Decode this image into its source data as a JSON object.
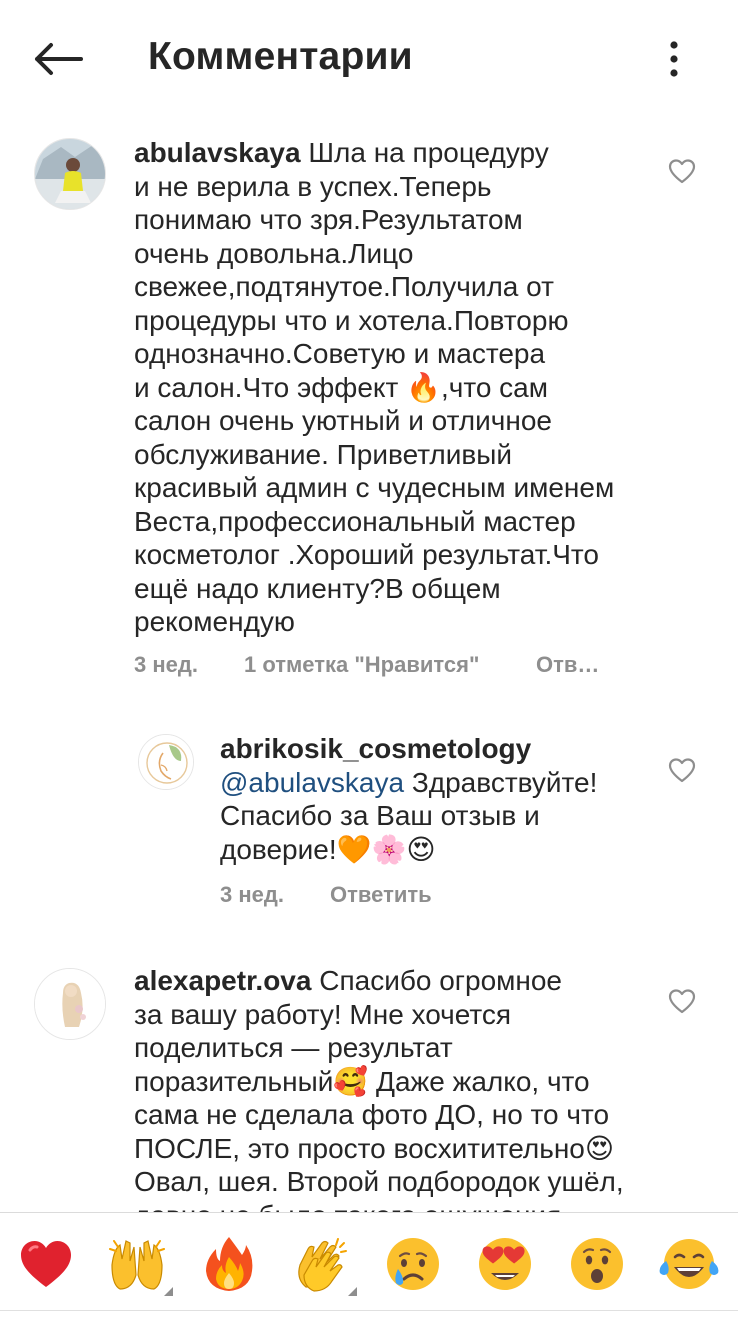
{
  "header": {
    "title": "Комментарии"
  },
  "comments": [
    {
      "username": "abulavskaya",
      "text_lines": [
        "Шла на процедуру",
        "и не верила в успех.Теперь",
        "понимаю что зря.Результатом",
        "очень довольна.Лицо",
        "свежее,подтянутое.Получила от",
        "процедуры что и хотела.Повторю",
        "однозначно.Советую и мастера",
        "и салон.Что эффект 🔥,что сам",
        "салон очень уютный и отличное",
        "обслуживание. Приветливый",
        "красивый админ с чудесным именем",
        "Веста,профессиональный мастер",
        "косметолог .Хороший результат.Что",
        "ещё надо клиенту?В общем",
        "рекомендую"
      ],
      "time": "3 нед.",
      "likes": "1 отметка \"Нравится\"",
      "reply": "Отв…"
    },
    {
      "username": "abrikosik_cosmetology",
      "mention": "@abulavskaya",
      "text_after_mention": " Здравствуйте!",
      "text_lines": [
        "Спасибо за Ваш отзыв и",
        "доверие!🧡🌸😍"
      ],
      "time": "3 нед.",
      "reply": "Ответить"
    },
    {
      "username": "alexapetr.ova",
      "text_lines": [
        "Спасибо огромное",
        "за вашу работу! Мне хочется",
        "поделиться — результат",
        "поразительный🥰 Даже жалко, что",
        "сама не сделала фото ДО, но то что",
        "ПОСЛЕ, это просто восхитительно😍",
        "Овал, шея. Второй подбородок ушёл,",
        "давно не было такого ощущения"
      ]
    }
  ],
  "emoji_bar": [
    {
      "char": "❤️",
      "name": "red-heart-emoji-button"
    },
    {
      "char": "🙌",
      "name": "raising-hands-emoji-button"
    },
    {
      "char": "🔥",
      "name": "fire-emoji-button"
    },
    {
      "char": "👏",
      "name": "clapping-hands-emoji-button"
    },
    {
      "char": "😢",
      "name": "crying-face-emoji-button"
    },
    {
      "char": "😍",
      "name": "heart-eyes-emoji-button"
    },
    {
      "char": "😮",
      "name": "surprised-face-emoji-button"
    },
    {
      "char": "😂",
      "name": "tears-of-joy-emoji-button"
    }
  ],
  "colors": {
    "text": "#262626",
    "meta": "#8e8e8e",
    "mention": "#1f4f7f",
    "divider": "#dbdbdb"
  }
}
